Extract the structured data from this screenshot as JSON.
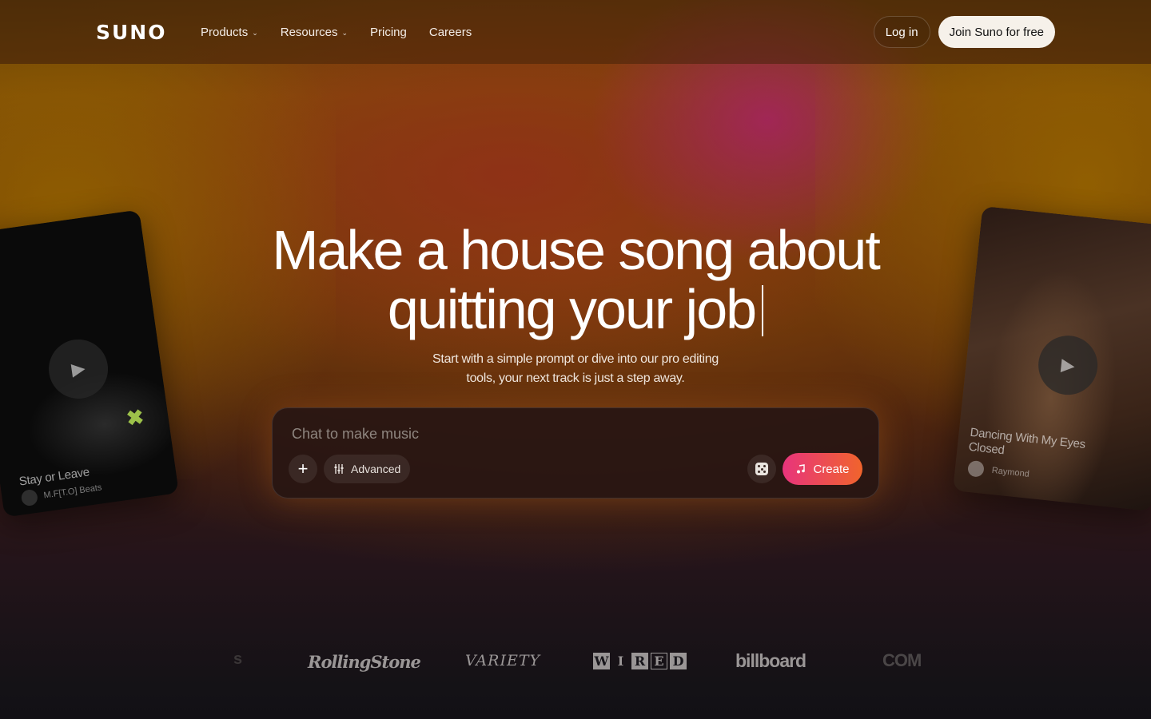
{
  "nav": {
    "logo": "SUNO",
    "links": [
      {
        "label": "Products",
        "has_dropdown": true
      },
      {
        "label": "Resources",
        "has_dropdown": true
      },
      {
        "label": "Pricing",
        "has_dropdown": false
      },
      {
        "label": "Careers",
        "has_dropdown": false
      }
    ],
    "login_label": "Log in",
    "join_label": "Join Suno for free"
  },
  "hero": {
    "title_line1": "Make a house song about",
    "title_line2": "quitting your job",
    "subtitle_line1": "Start with a simple prompt or dive into our pro editing",
    "subtitle_line2": "tools, your next track is just a step away."
  },
  "prompt": {
    "placeholder": "Chat to make music",
    "advanced_label": "Advanced",
    "create_label": "Create"
  },
  "cards": {
    "left": {
      "title": "Stay or Leave",
      "artist": "M.F[T.O] Beats"
    },
    "right": {
      "title": "Dancing With My Eyes Closed",
      "artist": "Raymond"
    }
  },
  "press": {
    "logos": [
      "s",
      "RollingStone",
      "VARIETY",
      "WIRED",
      "billboard",
      "COM"
    ]
  },
  "colors": {
    "create_gradient_start": "#e8347c",
    "create_gradient_end": "#f0642c",
    "join_button_bg": "#f6f1ea"
  },
  "icons": {
    "plus": "plus-icon",
    "advanced": "sliders-icon",
    "dice": "dice-icon",
    "create": "music-note-sparkle-icon",
    "play": "play-icon",
    "chevron": "chevron-down-icon"
  }
}
